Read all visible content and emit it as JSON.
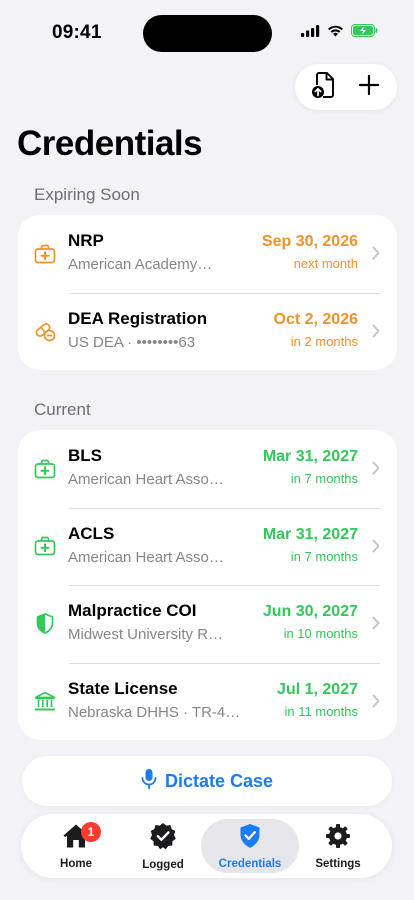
{
  "status_bar": {
    "time": "09:41"
  },
  "toolbar": {
    "import_icon": "document-import-icon",
    "add_icon": "plus-icon"
  },
  "page": {
    "title": "Credentials"
  },
  "sections": {
    "expiring": {
      "header": "Expiring Soon",
      "items": [
        {
          "icon": "first-aid-kit-icon",
          "title": "NRP",
          "subtitle": "American Academy…",
          "date": "Sep 30, 2026",
          "relative": "next month",
          "status_color": "#f0922b"
        },
        {
          "icon": "pill-icon",
          "title": "DEA Registration",
          "subtitle": "US DEA · ••••••••63",
          "date": "Oct 2, 2026",
          "relative": "in 2 months",
          "status_color": "#f0922b"
        }
      ]
    },
    "current": {
      "header": "Current",
      "items": [
        {
          "icon": "first-aid-kit-icon",
          "title": "BLS",
          "subtitle": "American Heart Asso…",
          "date": "Mar 31, 2027",
          "relative": "in 7 months",
          "status_color": "#34c759"
        },
        {
          "icon": "first-aid-kit-icon",
          "title": "ACLS",
          "subtitle": "American Heart Asso…",
          "date": "Mar 31, 2027",
          "relative": "in 7 months",
          "status_color": "#34c759"
        },
        {
          "icon": "shield-icon",
          "title": "Malpractice COI",
          "subtitle": "Midwest University R…",
          "date": "Jun 30, 2027",
          "relative": "in 10 months",
          "status_color": "#34c759"
        },
        {
          "icon": "bank-building-icon",
          "title": "State License",
          "subtitle": "Nebraska DHHS · TR-4…",
          "date": "Jul 1, 2027",
          "relative": "in 11 months",
          "status_color": "#34c759"
        }
      ]
    }
  },
  "dictate": {
    "label": "Dictate Case",
    "icon": "microphone-icon"
  },
  "tabbar": {
    "tabs": [
      {
        "label": "Home",
        "icon": "house-icon",
        "badge": "1"
      },
      {
        "label": "Logged",
        "icon": "checkmark-seal-icon"
      },
      {
        "label": "Credentials",
        "icon": "checkmark-shield-icon",
        "active": true
      },
      {
        "label": "Settings",
        "icon": "gear-icon"
      }
    ]
  },
  "colors": {
    "accent": "#1a7cf2",
    "warning": "#f0922b",
    "ok": "#34c759",
    "badge": "#ff3b30"
  }
}
